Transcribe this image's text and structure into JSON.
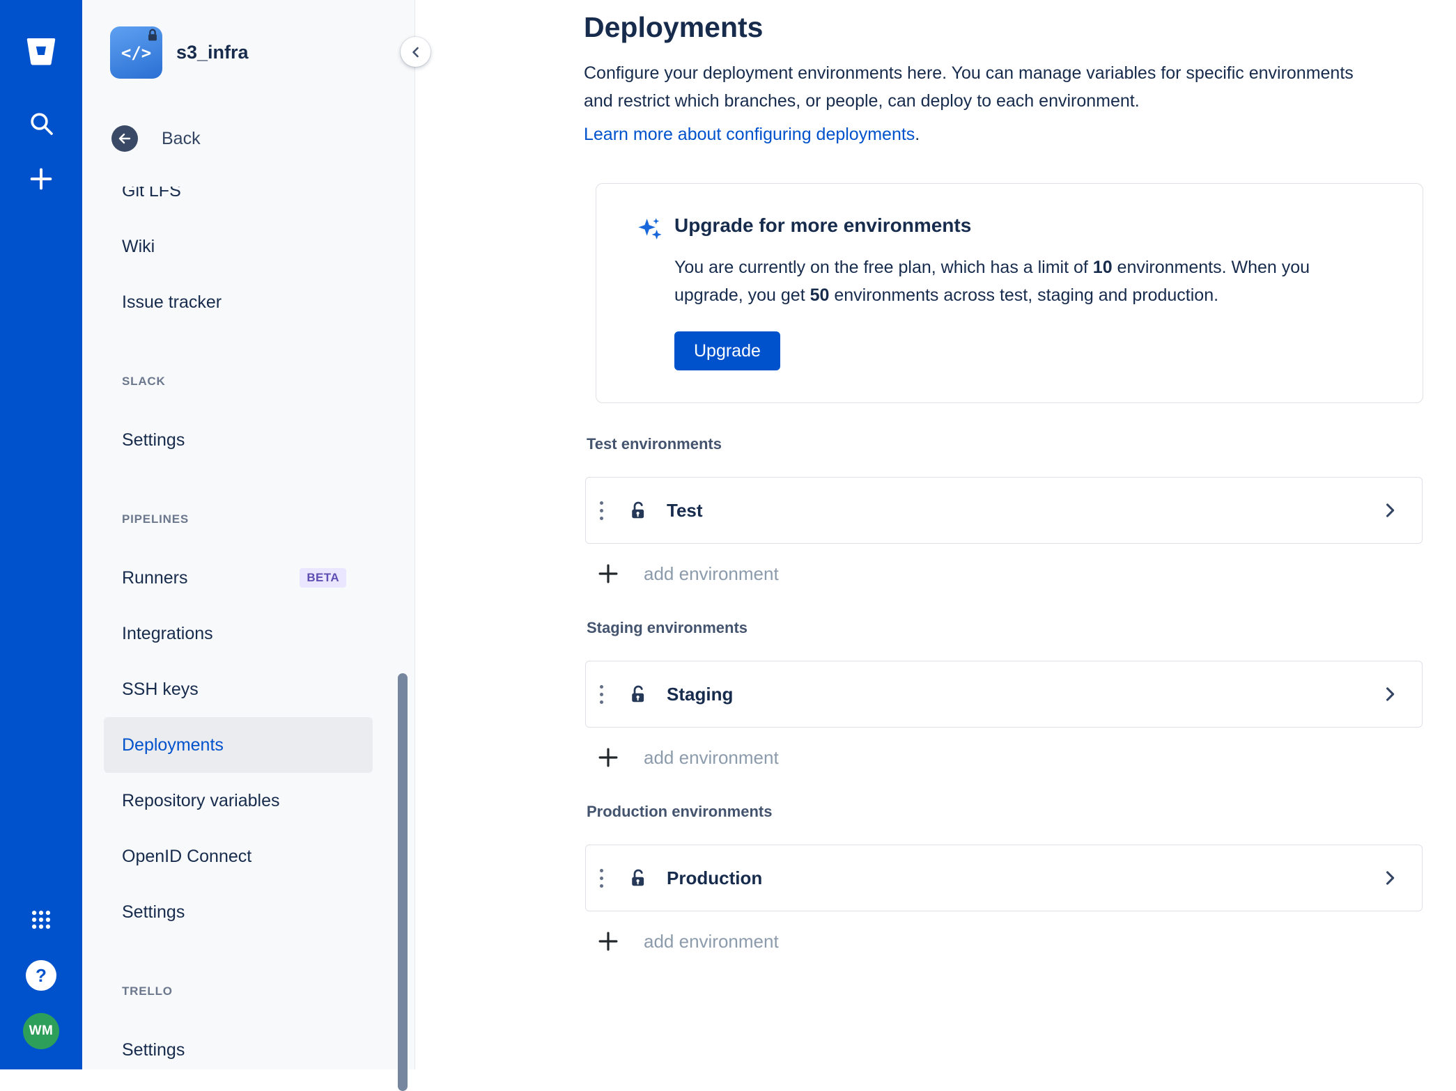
{
  "colors": {
    "nav_blue": "#0052CC",
    "link_blue": "#0052CC",
    "text_dark": "#172B4D",
    "text_subtle": "#6B778C",
    "section_label": "#44546F",
    "border": "#DFE1E6",
    "sidebar_bg": "#F8F9FA",
    "selected_bg": "#EBECF0",
    "beta_bg": "#EAE6FF",
    "beta_text": "#5E4DB2",
    "avatar_green": "#2E9E5B"
  },
  "global_nav": {
    "logo_icon": "bitbucket-logo",
    "search_icon": "search",
    "create_icon": "plus",
    "apps_icon": "app-switcher",
    "help_glyph": "?",
    "avatar_initials": "WM"
  },
  "sidebar": {
    "repo_name": "s3_infra",
    "repo_avatar_glyph": "</>",
    "back_label": "Back",
    "groups": [
      {
        "items": [
          {
            "label": "Git LFS"
          },
          {
            "label": "Wiki"
          },
          {
            "label": "Issue tracker"
          }
        ]
      },
      {
        "heading": "SLACK",
        "items": [
          {
            "label": "Settings"
          }
        ]
      },
      {
        "heading": "PIPELINES",
        "items": [
          {
            "label": "Runners",
            "badge": "BETA"
          },
          {
            "label": "Integrations"
          },
          {
            "label": "SSH keys"
          },
          {
            "label": "Deployments",
            "selected": true
          },
          {
            "label": "Repository variables"
          },
          {
            "label": "OpenID Connect"
          },
          {
            "label": "Settings"
          }
        ]
      },
      {
        "heading": "TRELLO",
        "items": [
          {
            "label": "Settings"
          }
        ]
      }
    ]
  },
  "main": {
    "title": "Deployments",
    "description": "Configure your deployment environments here. You can manage variables for specific environments and restrict which branches, or people, can deploy to each environment.",
    "learn_more": "Learn more about configuring deployments",
    "learn_more_suffix": ".",
    "upgrade_card": {
      "title": "Upgrade for more environments",
      "body_prefix": "You are currently on the free plan, which has a limit of ",
      "free_limit": "10",
      "body_middle": " environments. When you upgrade, you get ",
      "paid_limit": "50",
      "body_suffix": " environments across test, staging and production.",
      "button_label": "Upgrade"
    },
    "sections": [
      {
        "heading": "Test environments",
        "environment": "Test",
        "add_label": "add environment"
      },
      {
        "heading": "Staging environments",
        "environment": "Staging",
        "add_label": "add environment"
      },
      {
        "heading": "Production environments",
        "environment": "Production",
        "add_label": "add environment"
      }
    ]
  }
}
